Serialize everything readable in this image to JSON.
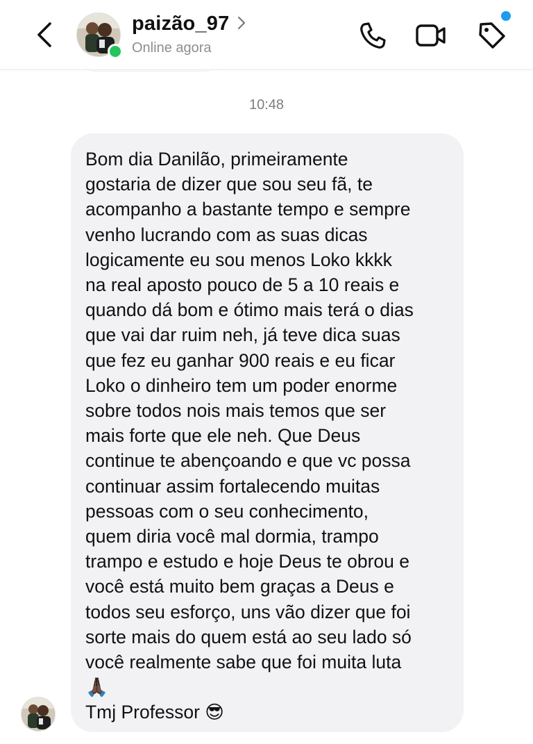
{
  "header": {
    "username": "paizão_97",
    "status": "Online agora",
    "back_icon": "chevron-left-icon",
    "chevron_icon": "chevron-right-icon",
    "actions": [
      {
        "name": "phone",
        "icon": "phone-icon"
      },
      {
        "name": "video",
        "icon": "video-camera-icon"
      },
      {
        "name": "tag",
        "icon": "tag-icon"
      }
    ],
    "online_color": "#22c55e",
    "notification_color": "#1c9bf0"
  },
  "conversation": {
    "timestamp": "10:48",
    "message": {
      "text": "Bom dia Danilão, primeiramente\ngostaria de dizer que sou seu fã, te\nacompanho a bastante tempo e sempre\nvenho lucrando com as suas dicas\nlogicamente eu sou menos Loko kkkk\nna real aposto pouco de 5 a 10 reais e\nquando dá bom e ótimo mais terá o dias\nque vai dar ruim neh, já teve dica suas\nque fez eu ganhar 900 reais e eu ficar\nLoko o dinheiro tem um poder enorme\nsobre todos nois mais temos que ser\nmais forte que ele neh. Que Deus\ncontinue te abençoando e que vc possa\ncontinuar assim fortalecendo muitas\npessoas com o seu conhecimento,\nquem diria você mal dormia, trampo\ntrampo e estudo e hoje Deus te obrou e\nvocê está muito bem graças a Deus e\ntodos seu esforço, uns vão dizer que foi\nsorte mais do quem está ao seu lado só\nvocê realmente sabe que foi muita luta\n🙏🏿\nTmj Professor 😎",
      "bubble_color": "#f2f2f5"
    }
  }
}
